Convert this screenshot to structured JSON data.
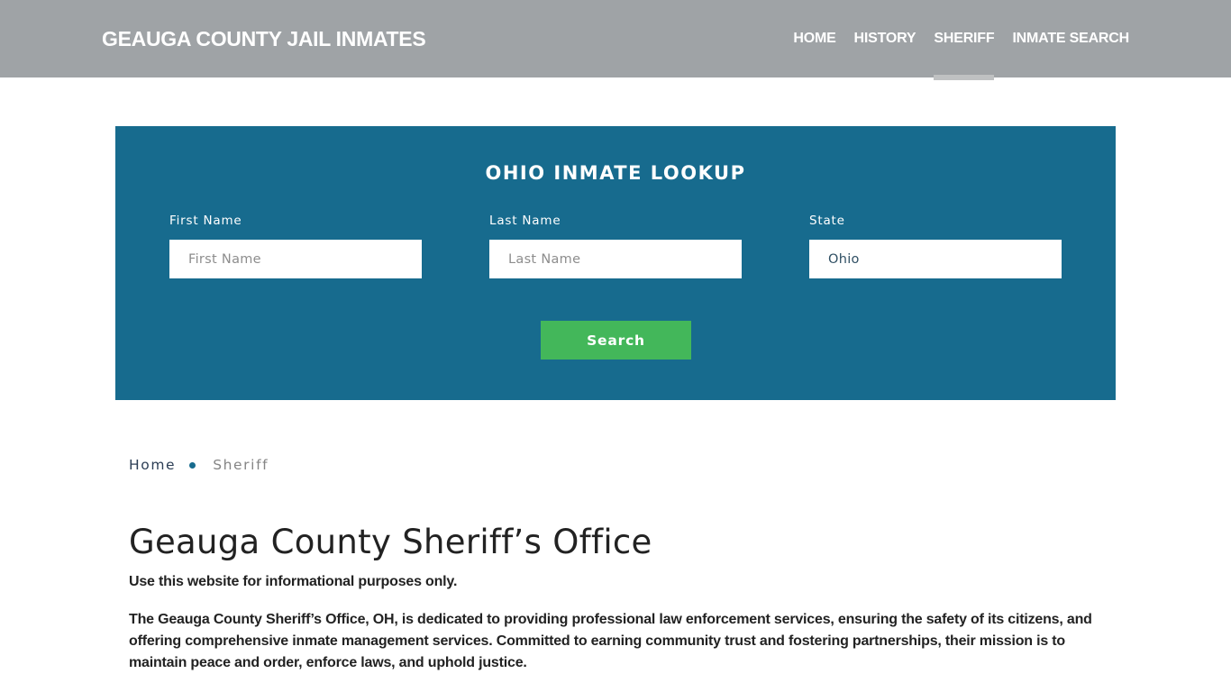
{
  "header": {
    "brand": "GEAUGA COUNTY JAIL INMATES",
    "nav": [
      {
        "label": "HOME",
        "active": false
      },
      {
        "label": "HISTORY",
        "active": false
      },
      {
        "label": "SHERIFF",
        "active": true
      },
      {
        "label": "INMATE SEARCH",
        "active": false
      }
    ]
  },
  "search": {
    "title": "OHIO INMATE LOOKUP",
    "first_name": {
      "label": "First Name",
      "placeholder": "First Name",
      "value": ""
    },
    "last_name": {
      "label": "Last Name",
      "placeholder": "Last Name",
      "value": ""
    },
    "state": {
      "label": "State",
      "selected": "Ohio"
    },
    "button_label": "Search"
  },
  "breadcrumb": {
    "home": "Home",
    "current": "Sheriff"
  },
  "main": {
    "title": "Geauga County Sheriff’s Office",
    "note": "Use this website for informational purposes only.",
    "description": "The Geauga County Sheriff’s Office, OH, is dedicated to providing professional law enforcement services, ensuring the safety of its citizens, and offering comprehensive inmate management services. Committed to earning community trust and fostering partnerships, their mission is to maintain peace and order, enforce laws, and uphold justice."
  },
  "colors": {
    "header_bg": "#9fa3a6",
    "panel_bg": "#176b8e",
    "button_bg": "#43b75a",
    "active_indicator": "#bfc1c2"
  }
}
